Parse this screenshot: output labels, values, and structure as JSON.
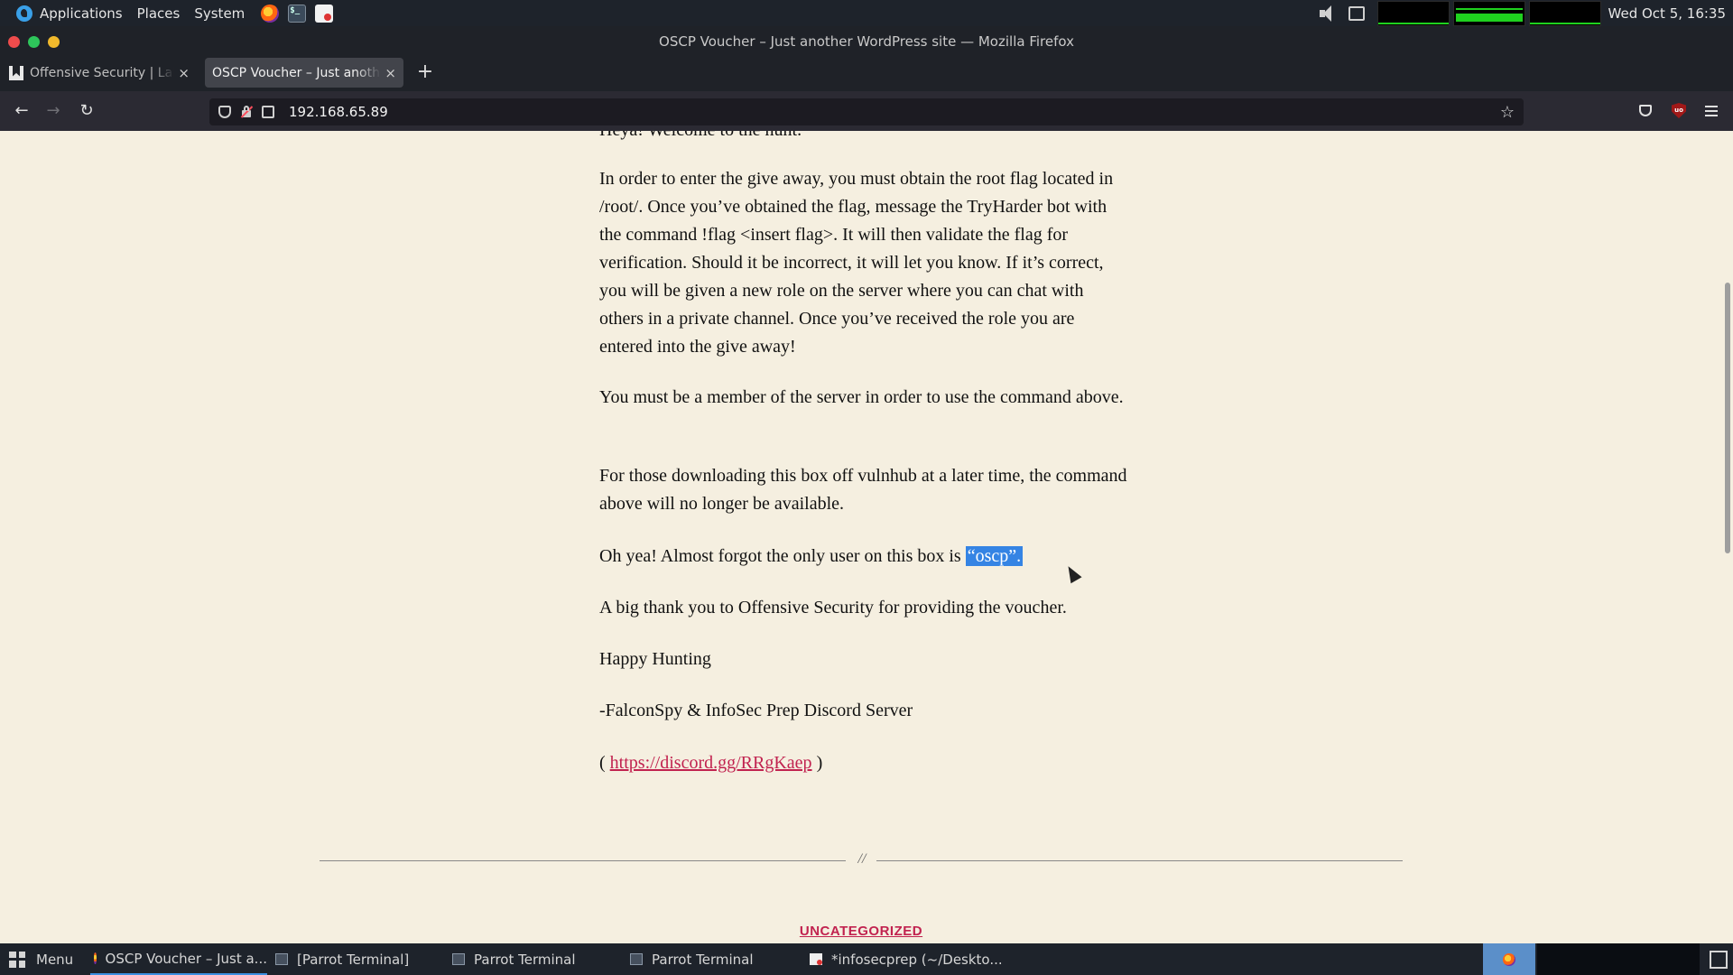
{
  "top_panel": {
    "menus": [
      "Applications",
      "Places",
      "System"
    ],
    "launchers": [
      "firefox-icon",
      "terminal-icon",
      "text-editor-icon"
    ],
    "clock": "Wed Oct  5, 16:35"
  },
  "window": {
    "title": "OSCP Voucher – Just another WordPress site — Mozilla Firefox"
  },
  "tabs": [
    {
      "title": "Offensive Security | Labs",
      "icon": "bookmark-icon",
      "active": false
    },
    {
      "title": "OSCP Voucher – Just another WordPress site",
      "icon": "",
      "active": true
    }
  ],
  "toolbar": {
    "url": "192.168.65.89",
    "new_tab": "+",
    "tab_close": "×"
  },
  "article": {
    "top_partial": "Heya! Welcome to the hunt.",
    "p1": "In order to enter the give away, you must obtain the root flag located in /root/. Once you’ve obtained the flag, message the TryHarder bot with the command !flag <insert flag>. It will then validate the flag for verification. Should it be incorrect, it will let you know. If it’s correct, you will be given a new role on the server where you can chat with others in a private channel. Once you’ve received the role you are entered into the give away!",
    "p2": "You must be a member of the server in order to use the command above.",
    "p3": "For those downloading this box off vulnhub at a later time, the command above will no longer be available.",
    "p4_before": "Oh yea! Almost forgot the only user on this box is ",
    "p4_selected": "“oscp”.",
    "p5": "A big thank you to Offensive Security for providing the voucher.",
    "p6": "Happy Hunting",
    "p7": "-FalconSpy & InfoSec Prep Discord Server",
    "link_open": "( ",
    "link": "https://discord.gg/RRgKaep",
    "link_close": " )",
    "divider_mark": "//",
    "category": "UNCATEGORIZED"
  },
  "taskbar": {
    "menu_label": "Menu",
    "tasks": [
      {
        "label": "OSCP Voucher – Just a...",
        "icon": "firefox-icon",
        "active": true
      },
      {
        "label": "[Parrot Terminal]",
        "icon": "terminal-icon",
        "active": false
      },
      {
        "label": "Parrot Terminal",
        "icon": "terminal-icon",
        "active": false
      },
      {
        "label": "Parrot Terminal",
        "icon": "terminal-icon",
        "active": false
      },
      {
        "label": "*infosecprep (~/Deskto...",
        "icon": "text-editor-icon",
        "active": false
      }
    ]
  }
}
